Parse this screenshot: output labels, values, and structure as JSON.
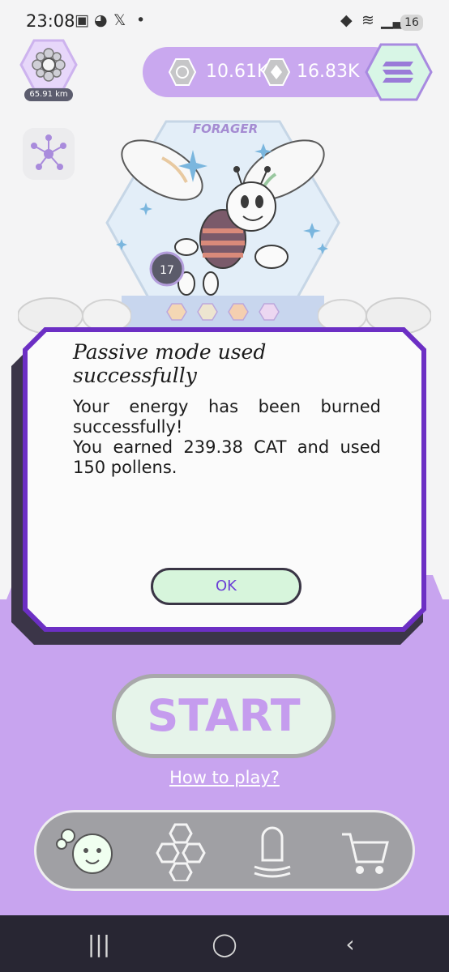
{
  "status_bar": {
    "time": "23:08",
    "battery": "16",
    "dot": "•"
  },
  "profile": {
    "distance": "65.91 km"
  },
  "currencies": [
    {
      "icon": "cat-coin-icon",
      "value": "10.61K"
    },
    {
      "icon": "pollen-coin-icon",
      "value": "16.83K"
    }
  ],
  "card": {
    "title": "FORAGER",
    "level_badge": "17"
  },
  "dialog": {
    "title": "Passive mode used successfully",
    "body_line1": "Your energy has been burned successfully!",
    "body_line2": "You earned 239.38 CAT and used 150 pollens.",
    "ok_label": "OK"
  },
  "main": {
    "start_label": "START",
    "how_to_play": "How to play?"
  },
  "bottom_nav": {
    "items": [
      "bee-home-icon",
      "hive-icon",
      "capsule-icon",
      "cart-icon"
    ]
  },
  "system_nav": {
    "recents": "|||",
    "home": "◯",
    "back": "‹"
  },
  "colors": {
    "accent_purple": "#c8a4ef",
    "dialog_border": "#6c2fc4",
    "ok_bg": "#d7f5dc"
  }
}
